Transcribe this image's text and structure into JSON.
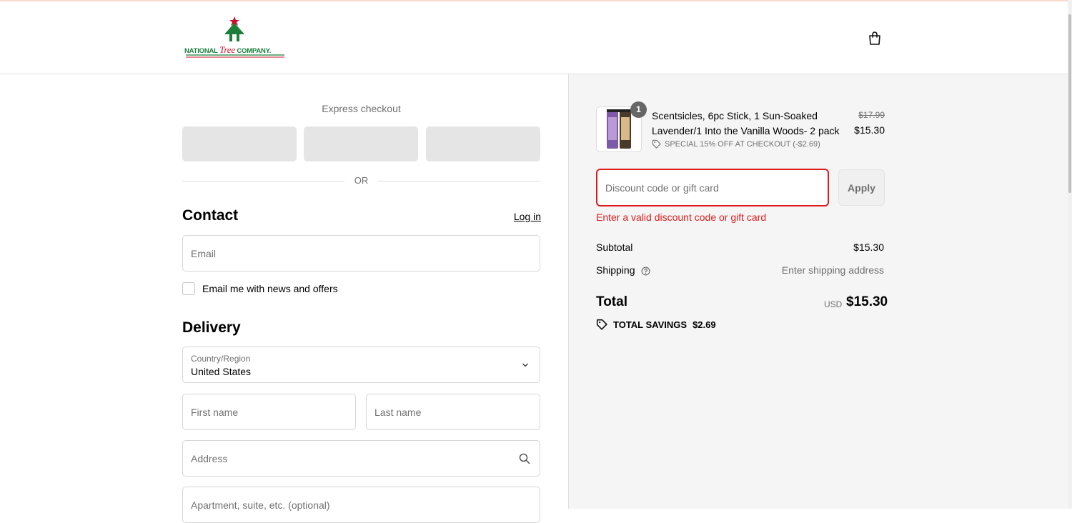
{
  "header": {
    "logo": {
      "word_left": "NATIONAL",
      "word_middle": "Tree",
      "word_right": "COMPANY."
    },
    "cart_icon": "shopping-bag-icon"
  },
  "express": {
    "label": "Express checkout",
    "or": "OR"
  },
  "contact": {
    "heading": "Contact",
    "login_link": "Log in",
    "email_placeholder": "Email",
    "newsletter_label": "Email me with news and offers",
    "newsletter_checked": false
  },
  "delivery": {
    "heading": "Delivery",
    "country_caption": "Country/Region",
    "country_value": "United States",
    "first_name_placeholder": "First name",
    "last_name_placeholder": "Last name",
    "address_placeholder": "Address",
    "apartment_placeholder": "Apartment, suite, etc. (optional)"
  },
  "summary": {
    "item": {
      "quantity": "1",
      "title": "Scentsicles, 6pc Stick, 1 Sun-Soaked Lavender/1 Into the Vanilla Woods- 2 pack",
      "discount": "SPECIAL 15% OFF AT CHECKOUT (-$2.69)",
      "original_price": "$17.99",
      "price": "$15.30"
    },
    "discount_placeholder": "Discount code or gift card",
    "apply_label": "Apply",
    "error": "Enter a valid discount code or gift card",
    "subtotal_label": "Subtotal",
    "subtotal_value": "$15.30",
    "shipping_label": "Shipping",
    "shipping_value": "Enter shipping address",
    "total_label": "Total",
    "total_currency": "USD",
    "total_value": "$15.30",
    "savings_label": "TOTAL SAVINGS",
    "savings_value": "$2.69"
  },
  "colors": {
    "error": "#dd1d1d",
    "brand_green": "#1b7f3a",
    "brand_red": "#c8102e",
    "summary_bg": "#f5f5f5"
  }
}
